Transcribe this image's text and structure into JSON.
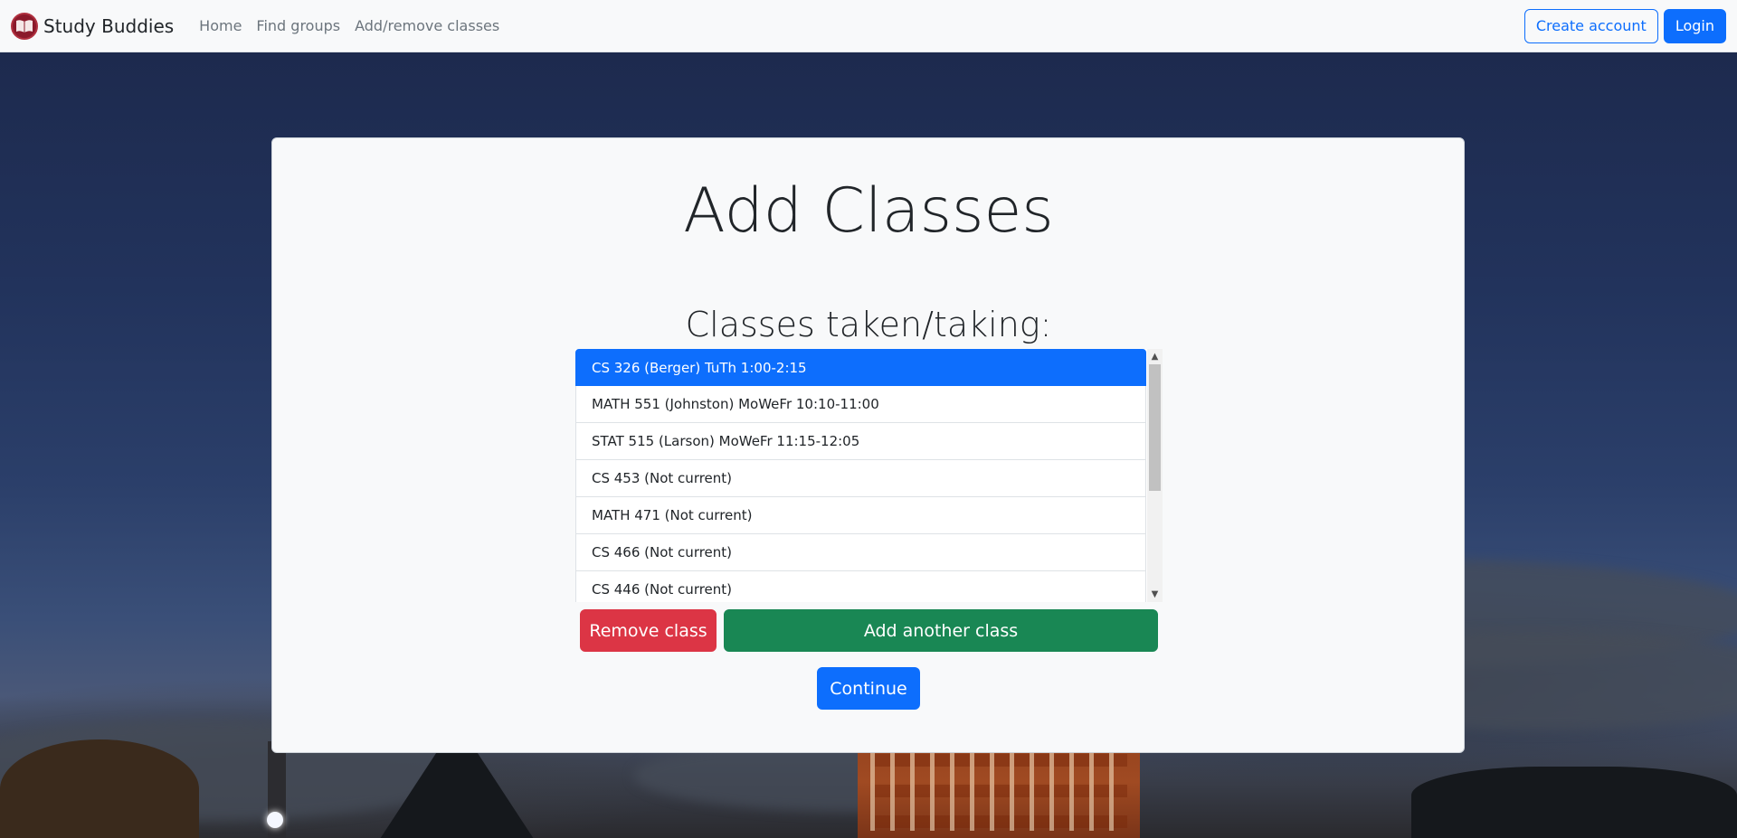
{
  "navbar": {
    "brand": "Study Buddies",
    "links": [
      "Home",
      "Find groups",
      "Add/remove classes"
    ],
    "create_account": "Create account",
    "login": "Login"
  },
  "main": {
    "title": "Add Classes",
    "subtitle": "Classes taken/taking:",
    "classes": [
      "CS 326 (Berger) TuTh 1:00-2:15",
      "MATH 551 (Johnston) MoWeFr 10:10-11:00",
      "STAT 515 (Larson) MoWeFr 11:15-12:05",
      "CS 453 (Not current)",
      "MATH 471 (Not current)",
      "CS 466 (Not current)",
      "CS 446 (Not current)"
    ],
    "selected_index": 0,
    "remove_label": "Remove class",
    "add_label": "Add another class",
    "continue_label": "Continue"
  },
  "colors": {
    "primary": "#0d6efd",
    "danger": "#dc3545",
    "success": "#198754",
    "logo": "#8b1a2b"
  },
  "icons": {
    "logo": "book-icon",
    "scroll_up": "chevron-up-icon",
    "scroll_down": "chevron-down-icon"
  }
}
